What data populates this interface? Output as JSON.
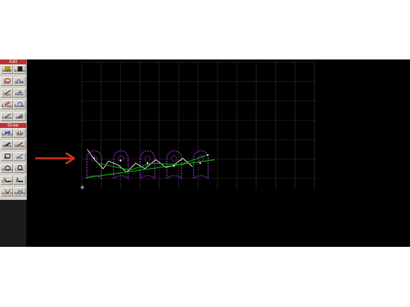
{
  "palette": {
    "edit_header": "Edit",
    "draw_header": "Draw",
    "grip": "• • • • •",
    "tools": [
      {
        "label": "Select",
        "icon": "select-arrow-icon"
      },
      {
        "label": "Unselect",
        "icon": "unselect-icon"
      },
      {
        "label": "Size",
        "icon": "size-icon"
      },
      {
        "label": "Mirror",
        "icon": "mirror-icon"
      },
      {
        "label": "Copy",
        "icon": "copy-icon"
      },
      {
        "label": "Move",
        "icon": "move-icon"
      },
      {
        "label": "B.Copy",
        "icon": "b-copy-icon"
      },
      {
        "label": "Rotate",
        "icon": "rotate-icon"
      },
      {
        "label": "Frame",
        "icon": "frame-icon"
      },
      {
        "label": "Shell",
        "icon": "shell-icon"
      },
      {
        "label": "Set Zero",
        "icon": "set-zero-icon"
      },
      {
        "label": "Text",
        "icon": "text-abc-icon"
      },
      {
        "label": "Offset",
        "icon": "offset-icon"
      },
      {
        "label": "Divide",
        "icon": "divide-icon"
      },
      {
        "label": "Box",
        "icon": "box-icon"
      },
      {
        "label": "Line",
        "icon": "line-icon"
      },
      {
        "label": "Shapes",
        "icon": "shapes-icon"
      },
      {
        "label": "Circle",
        "icon": "circle-icon"
      },
      {
        "label": "Chamfer",
        "icon": "chamfer-icon"
      },
      {
        "label": "Fillet",
        "icon": "fillet-icon"
      },
      {
        "label": "Lead In",
        "icon": "lead-in-icon"
      },
      {
        "label": "AutoPath",
        "icon": "autopath-icon"
      }
    ]
  },
  "colors": {
    "grid": "#3a3a3a",
    "shape_outline": "#a030d0",
    "cut_path": "#00c000",
    "rapid_path": "#ffffff",
    "pierce": "#ffffff",
    "annotation_arrow": "#c83020"
  }
}
